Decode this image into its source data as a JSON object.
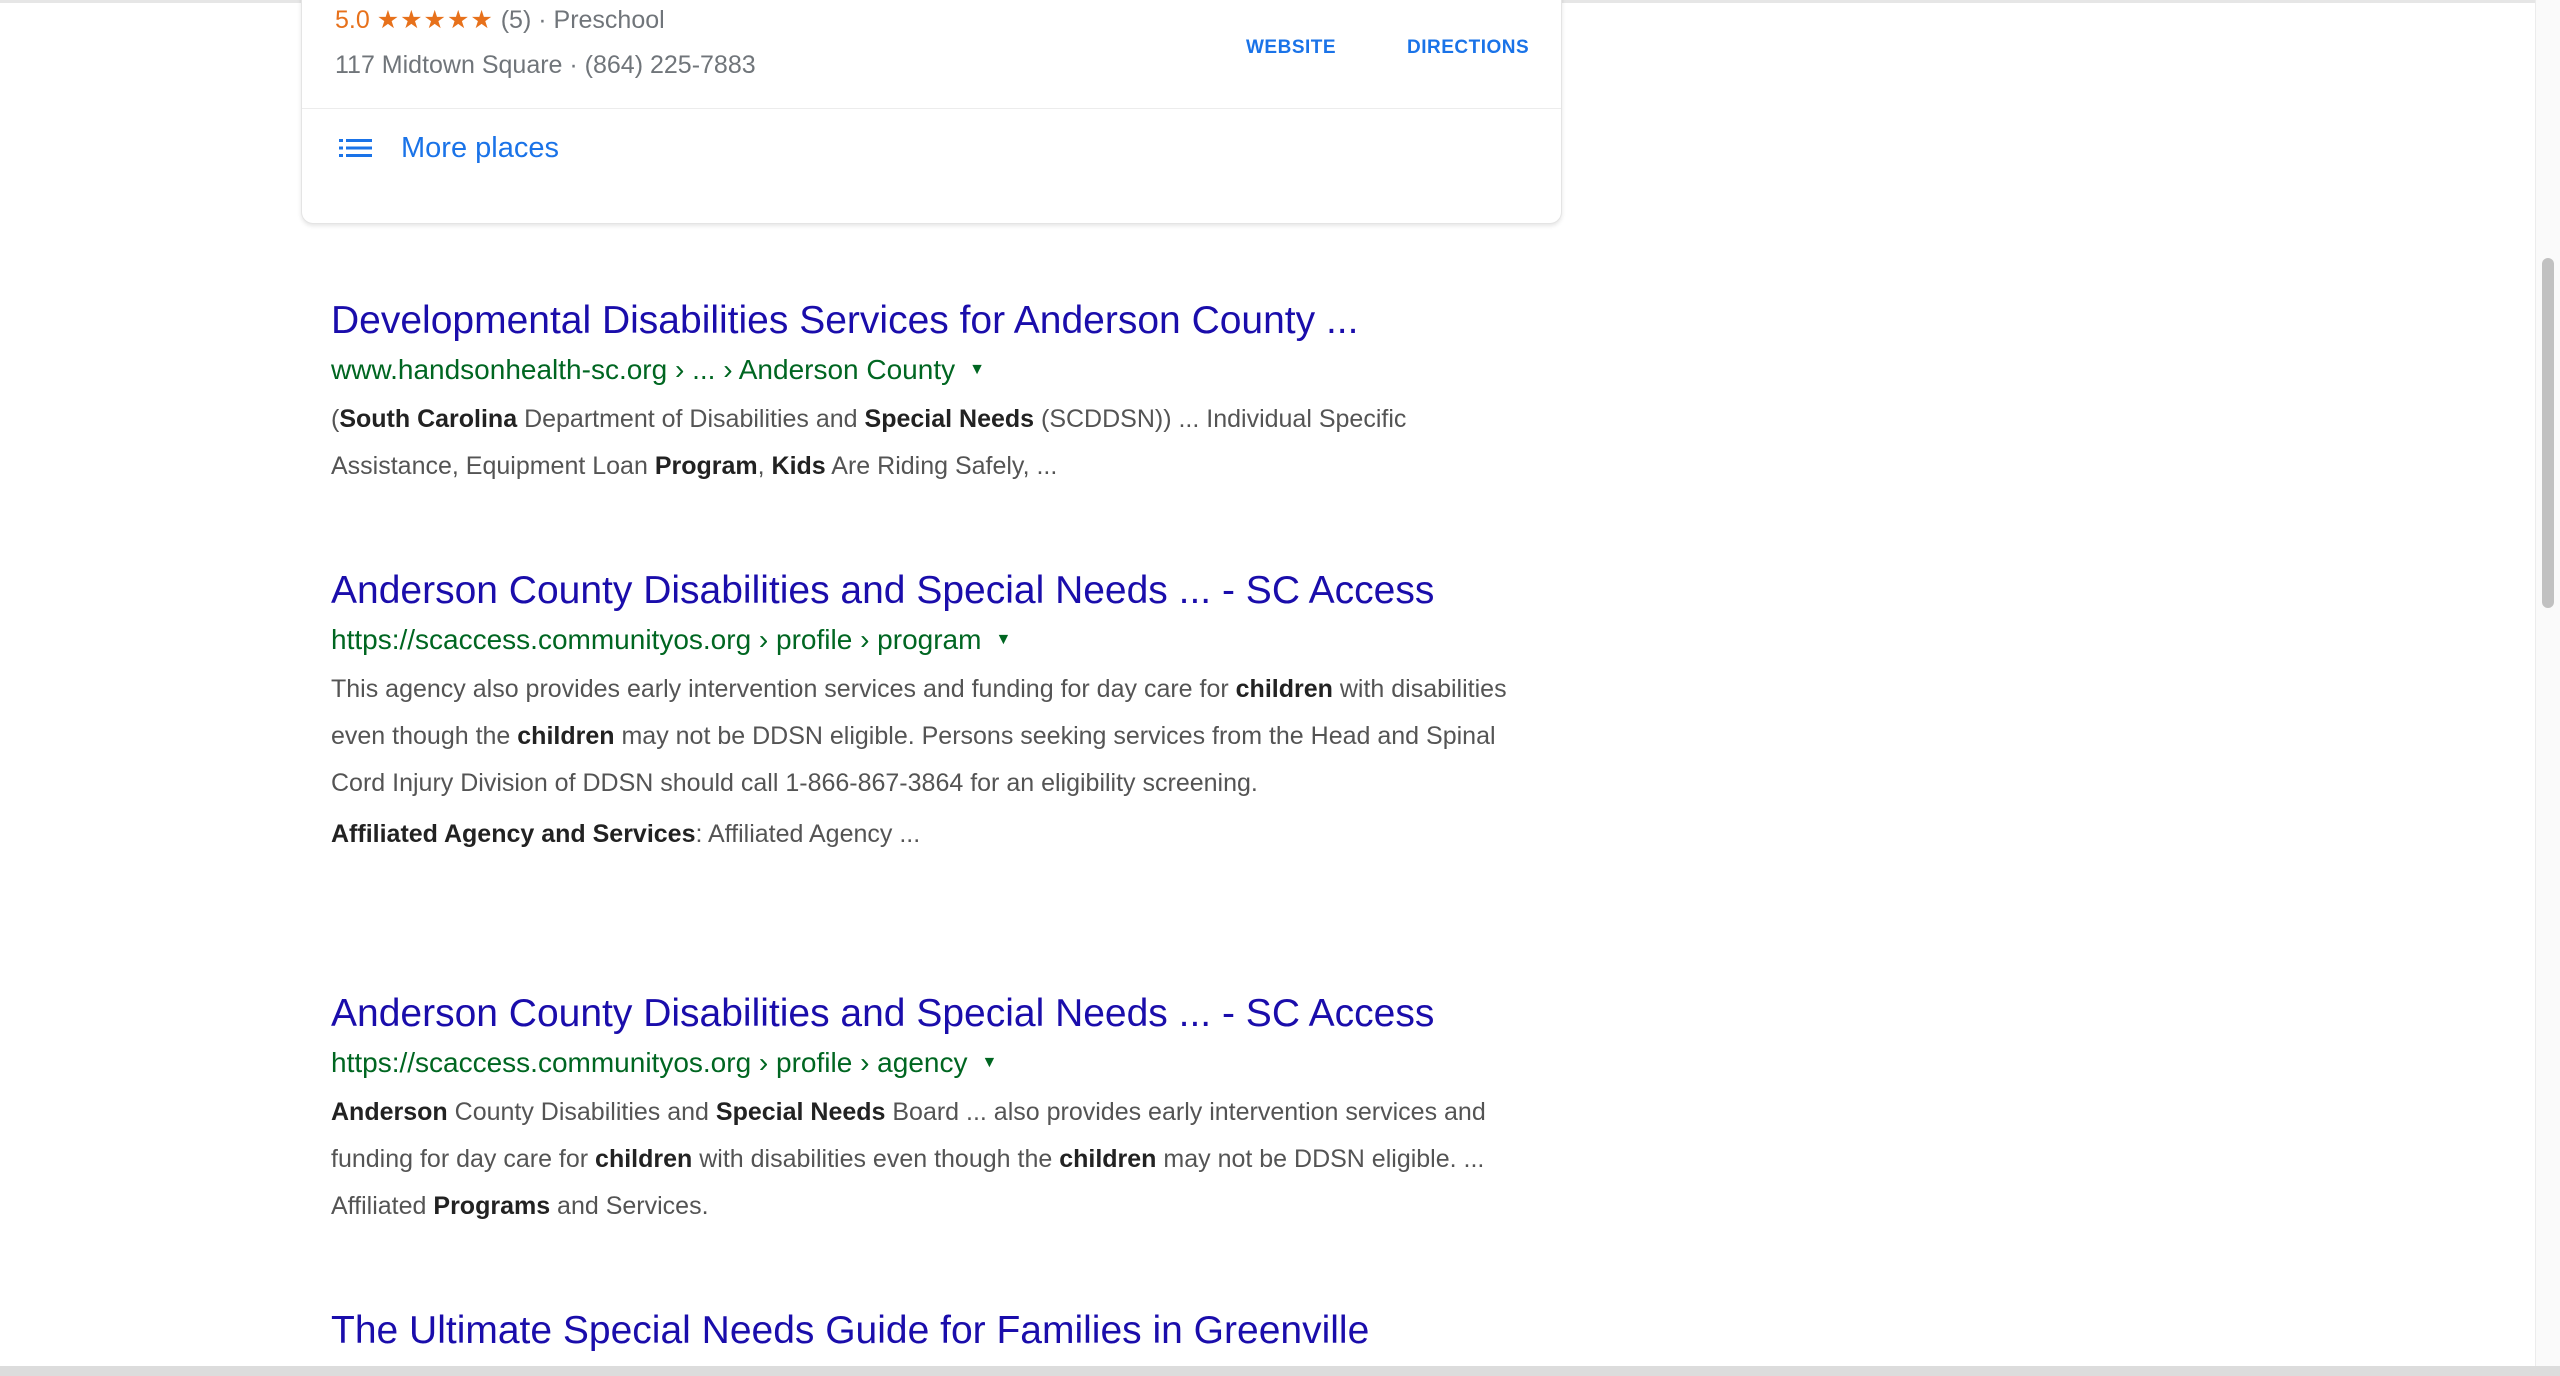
{
  "local_result": {
    "rating": "5.0",
    "stars": "★★★★★",
    "review_count": "(5)",
    "separator": "·",
    "category": "Preschool",
    "address": "117 Midtown Square · (864) 225-7883",
    "website_label": "WEBSITE",
    "directions_label": "DIRECTIONS"
  },
  "more_places": {
    "icon": "list-icon",
    "label": "More places"
  },
  "results": [
    {
      "title": "Developmental Disabilities Services for Anderson County ...",
      "url": "www.handsonhealth-sc.org › ... › Anderson County",
      "snippet": [
        {
          "text": "(",
          "bold": false
        },
        {
          "text": "South Carolina",
          "bold": true
        },
        {
          "text": " Department of Disabilities and ",
          "bold": false
        },
        {
          "text": "Special Needs",
          "bold": true
        },
        {
          "text": " (SCDDSN)) ... Individual Specific Assistance, Equipment Loan ",
          "bold": false
        },
        {
          "text": "Program",
          "bold": true
        },
        {
          "text": ", ",
          "bold": false
        },
        {
          "text": "Kids",
          "bold": true
        },
        {
          "text": " Are Riding Safely, ...",
          "bold": false
        }
      ]
    },
    {
      "title": "Anderson County Disabilities and Special Needs ... - SC Access",
      "url": "https://scaccess.communityos.org › profile › program",
      "snippet": [
        {
          "text": "This agency also provides early intervention services and funding for day care for ",
          "bold": false
        },
        {
          "text": "children",
          "bold": true
        },
        {
          "text": " with disabilities even though the ",
          "bold": false
        },
        {
          "text": "children",
          "bold": true
        },
        {
          "text": " may not be DDSN eligible. Persons seeking services from the Head and Spinal Cord Injury Division of DDSN should call 1-866-867-3864 for an eligibility screening.",
          "bold": false
        }
      ],
      "extra_label": "Affiliated Agency and Services",
      "extra_text": ": Affiliated Agency ..."
    },
    {
      "title": "Anderson County Disabilities and Special Needs ... - SC Access",
      "url": "https://scaccess.communityos.org › profile › agency",
      "snippet": [
        {
          "text": "Anderson",
          "bold": true
        },
        {
          "text": " County Disabilities and ",
          "bold": false
        },
        {
          "text": "Special Needs",
          "bold": true
        },
        {
          "text": " Board ... also provides early intervention services and funding for day care for ",
          "bold": false
        },
        {
          "text": "children",
          "bold": true
        },
        {
          "text": " with disabilities even though the ",
          "bold": false
        },
        {
          "text": "children",
          "bold": true
        },
        {
          "text": " may not be DDSN eligible. ... Affiliated ",
          "bold": false
        },
        {
          "text": "Programs",
          "bold": true
        },
        {
          "text": " and Services.",
          "bold": false
        }
      ]
    },
    {
      "title": "The Ultimate Special Needs Guide for Families in Greenville"
    }
  ],
  "colors": {
    "link": "#1a0dab",
    "url_green": "#006621",
    "snippet_gray": "#545454",
    "rating_orange": "#e7711b",
    "action_blue": "#1a73e8"
  }
}
